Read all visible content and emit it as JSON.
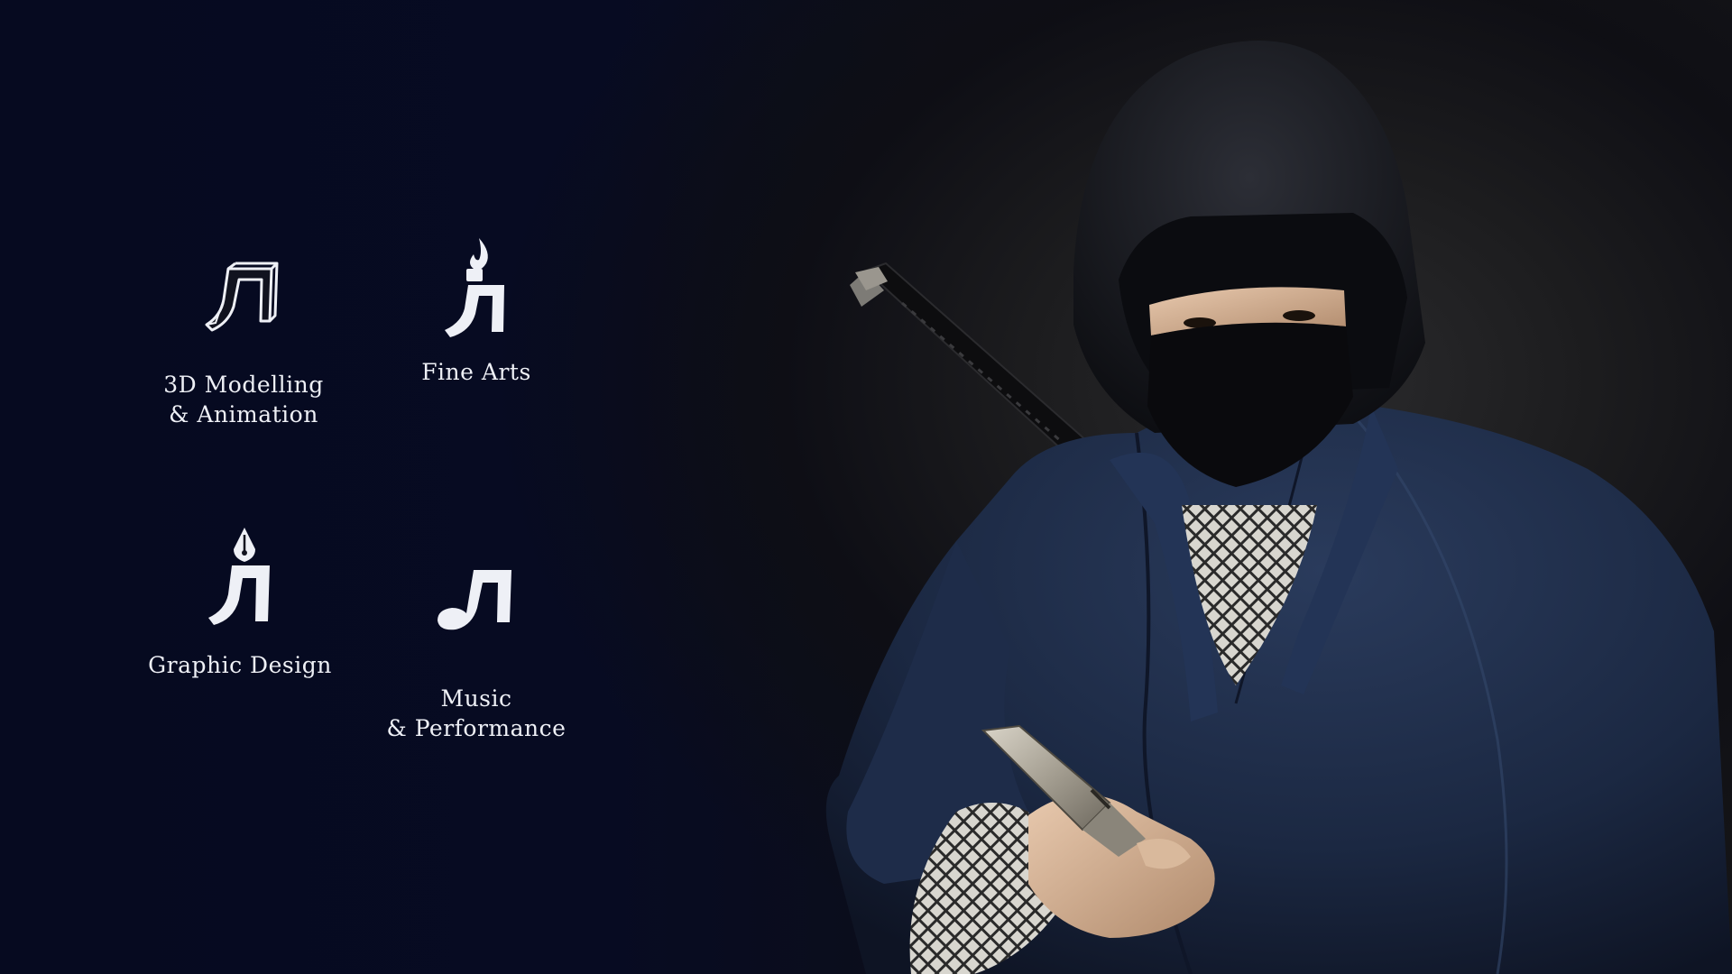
{
  "disciplines": [
    {
      "line1": "3D Modelling",
      "line2": "& Animation",
      "icon": "3d-cube-icon"
    },
    {
      "line1": "Fine Arts",
      "line2": "",
      "icon": "brush-flame-icon"
    },
    {
      "line1": "Graphic Design",
      "line2": "",
      "icon": "pen-nib-icon"
    },
    {
      "line1": "Music",
      "line2": "& Performance",
      "icon": "music-note-icon"
    }
  ],
  "colors": {
    "background": "#05081a",
    "text": "#eef0f6",
    "robe": "#1c2a44"
  }
}
